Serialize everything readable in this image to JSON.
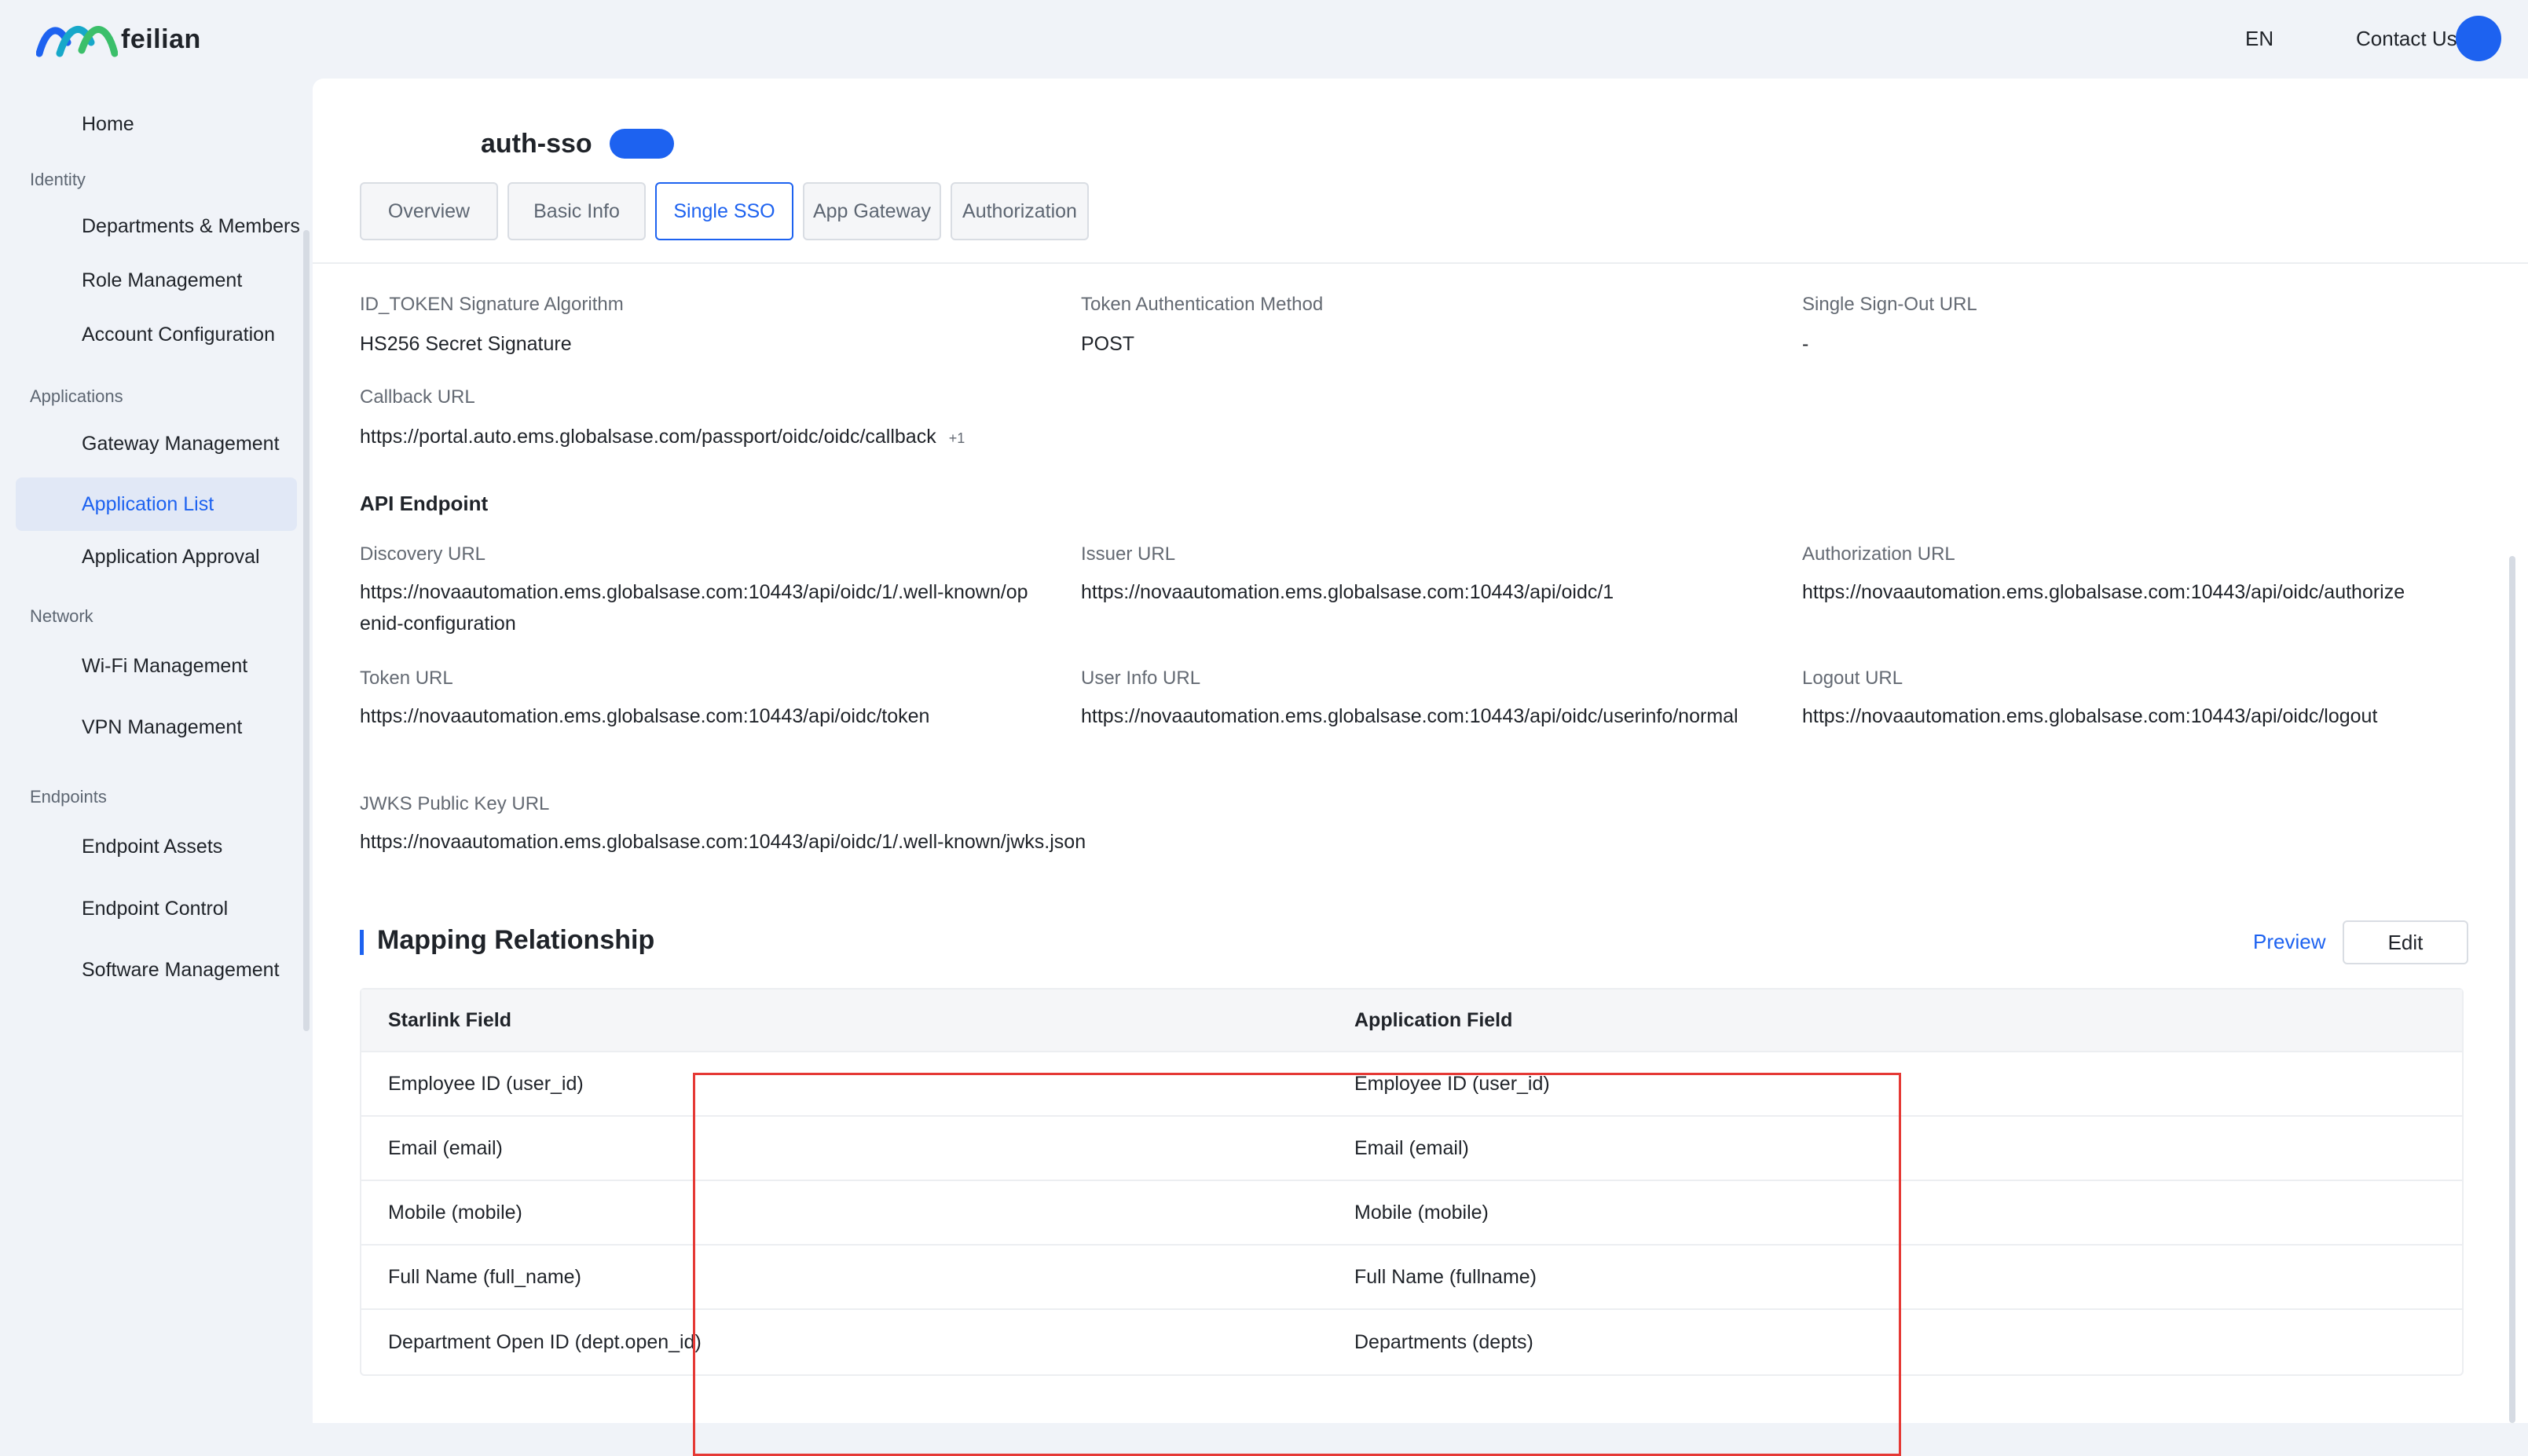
{
  "header": {
    "brand": "feilian",
    "language": "EN",
    "contact": "Contact Us"
  },
  "sidebar": {
    "home": "Home",
    "groups": {
      "identity": "Identity",
      "applications": "Applications",
      "network": "Network",
      "endpoints": "Endpoints"
    },
    "items": {
      "departments": "Departments & Members",
      "role": "Role Management",
      "account": "Account Configuration",
      "gateway": "Gateway Management",
      "app_list": "Application List",
      "app_approval": "Application Approval",
      "wifi": "Wi-Fi Management",
      "vpn": "VPN Management",
      "endpoint_assets": "Endpoint Assets",
      "endpoint_control": "Endpoint Control",
      "software": "Software Management"
    },
    "active_item": "Application List"
  },
  "app": {
    "name": "auth-sso",
    "enabled": true,
    "tabs": [
      "Overview",
      "Basic Info",
      "Single SSO",
      "App Gateway",
      "Authorization"
    ],
    "active_tab": "Single SSO"
  },
  "sso": {
    "id_token_label": "ID_TOKEN Signature Algorithm",
    "id_token_value": "HS256 Secret Signature",
    "token_auth_label": "Token Authentication Method",
    "token_auth_value": "POST",
    "signout_label": "Single Sign-Out URL",
    "signout_value": "-",
    "callback_label": "Callback URL",
    "callback_value": "https://portal.auto.ems.globalsase.com/passport/oidc/oidc/callback",
    "callback_more": "+1"
  },
  "api": {
    "heading": "API Endpoint",
    "discovery_label": "Discovery URL",
    "discovery_value": "https://novaautomation.ems.globalsase.com:10443/api/oidc/1/.well-known/openid-configuration",
    "issuer_label": "Issuer URL",
    "issuer_value": "https://novaautomation.ems.globalsase.com:10443/api/oidc/1",
    "authorization_label": "Authorization URL",
    "authorization_value": "https://novaautomation.ems.globalsase.com:10443/api/oidc/authorize",
    "token_label": "Token URL",
    "token_value": "https://novaautomation.ems.globalsase.com:10443/api/oidc/token",
    "userinfo_label": "User Info URL",
    "userinfo_value": "https://novaautomation.ems.globalsase.com:10443/api/oidc/userinfo/normal",
    "logout_label": "Logout URL",
    "logout_value": "https://novaautomation.ems.globalsase.com:10443/api/oidc/logout",
    "jwks_label": "JWKS Public Key URL",
    "jwks_value": "https://novaautomation.ems.globalsase.com:10443/api/oidc/1/.well-known/jwks.json"
  },
  "mapping": {
    "title": "Mapping Relationship",
    "preview": "Preview",
    "edit": "Edit",
    "columns": [
      "Starlink Field",
      "Application Field"
    ],
    "rows": [
      [
        "Employee ID (user_id)",
        "Employee ID (user_id)"
      ],
      [
        "Email (email)",
        "Email (email)"
      ],
      [
        "Mobile (mobile)",
        "Mobile (mobile)"
      ],
      [
        "Full Name (full_name)",
        "Full Name (fullname)"
      ],
      [
        "Department Open ID (dept.open_id)",
        "Departments (depts)"
      ]
    ]
  },
  "colors": {
    "accent": "#1d62f0",
    "highlight": "#e53935",
    "background": "#f0f3f8"
  }
}
